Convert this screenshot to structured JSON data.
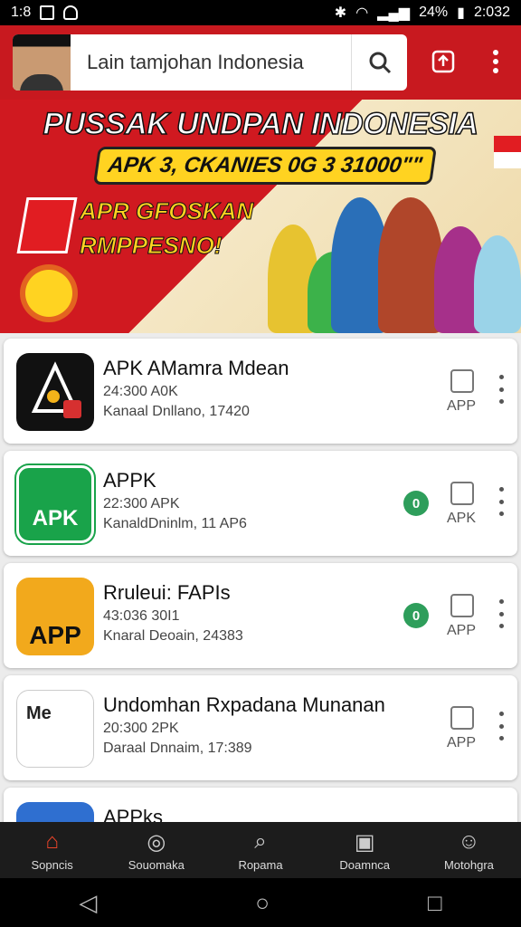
{
  "status": {
    "time_left": "1:8",
    "battery": "24%",
    "clock": "2:032"
  },
  "search": {
    "placeholder": "Lain tamjohan Indonesia"
  },
  "banner": {
    "title": "PUSSAK UNDPAN INDONESIA",
    "pill": "APK 3, CKANIES 0G 3 31000\"\"",
    "sub1": "APR GFOSKAN",
    "sub2": "RMPPESNO!"
  },
  "apps": [
    {
      "title": "APK AMamra Mdean",
      "line2": "24:300 A0K",
      "line3": "Kanaal Dnllano, 17420",
      "badge": "",
      "action": "APP",
      "icon_text": "",
      "icon_bg": "#111111"
    },
    {
      "title": "APPK",
      "line2": "22:300 APK",
      "line3": "KanaldDninlm, 11 AP6",
      "badge": "0",
      "action": "APK",
      "icon_text": "APK",
      "icon_bg": "#19a34a"
    },
    {
      "title": "Rruleui: FAPIs",
      "line2": "43:036 30I1",
      "line3": "Knaral Deoain, 24383",
      "badge": "0",
      "action": "APP",
      "icon_text": "APP",
      "icon_bg": "#f2a91c"
    },
    {
      "title": "Undomhan Rxpadana Munanan",
      "line2": "20:300 2PK",
      "line3": "Daraal Dnnaim, 17:389",
      "badge": "",
      "action": "APP",
      "icon_text": "Me",
      "icon_bg": "#ffffff"
    },
    {
      "title": "APPks",
      "line2": "",
      "line3": "",
      "badge": "",
      "action": "",
      "icon_text": "",
      "icon_bg": "#2f6fd0"
    }
  ],
  "bottom_nav": [
    "Sopncis",
    "Souomaka",
    "Ropama",
    "Doamnca",
    "Motohgra"
  ],
  "icons": [
    "home-icon",
    "leaf-icon",
    "search-icon",
    "bookmark-icon",
    "profile-icon"
  ]
}
